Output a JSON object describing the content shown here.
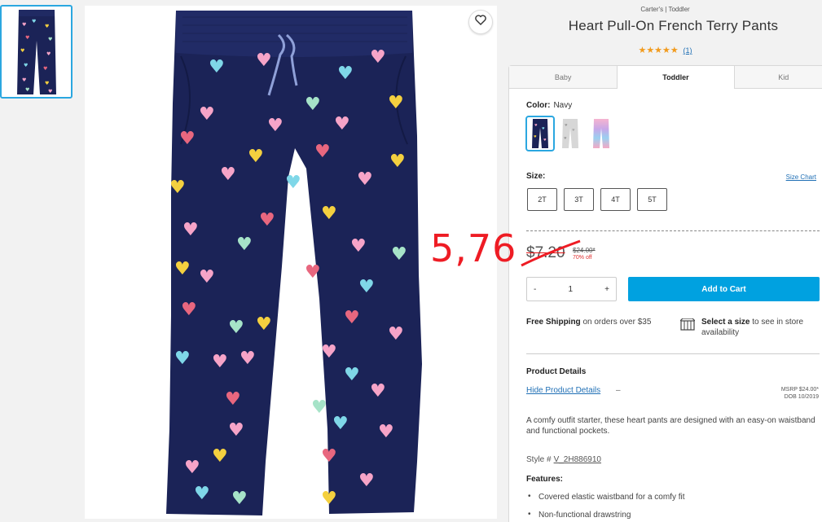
{
  "product": {
    "brand_line": "Carter's | Toddler",
    "title": "Heart Pull-On French Terry Pants",
    "stars": "★★★★★",
    "rating_count": "(1)"
  },
  "tabs": [
    {
      "label": "Baby"
    },
    {
      "label": "Toddler"
    },
    {
      "label": "Kid"
    }
  ],
  "color": {
    "label": "Color:",
    "selected": "Navy"
  },
  "size": {
    "label": "Size:",
    "chart_link": "Size Chart",
    "options": [
      "2T",
      "3T",
      "4T",
      "5T"
    ]
  },
  "pricing": {
    "price": "$7.20",
    "was": "$24.00*",
    "discount": "70% off"
  },
  "quantity": {
    "minus": "-",
    "value": "1",
    "plus": "+"
  },
  "add_to_cart": "Add to Cart",
  "shipping": {
    "bold": "Free Shipping",
    "rest": " on orders over $35"
  },
  "store": {
    "bold": "Select a size",
    "rest": " to see in store availability"
  },
  "details": {
    "title": "Product Details",
    "hide_link": "Hide Product Details",
    "hide_dash": "–",
    "msrp": "MSRP $24.00*",
    "dob": "DOB 10/2019",
    "description": "A comfy outfit starter, these heart pants are designed with an easy-on waistband and functional pockets.",
    "style_label": "Style #",
    "style_number": "V_2H886910",
    "features_title": "Features:",
    "features": [
      "Covered elastic waistband for a comfy fit",
      "Non-functional drawstring"
    ]
  },
  "annotation": {
    "text": "5,76",
    "color": "#ee1c24"
  },
  "colors": {
    "accent": "#00a1e0",
    "star": "#f29b1d",
    "navy": "#1b2357"
  }
}
